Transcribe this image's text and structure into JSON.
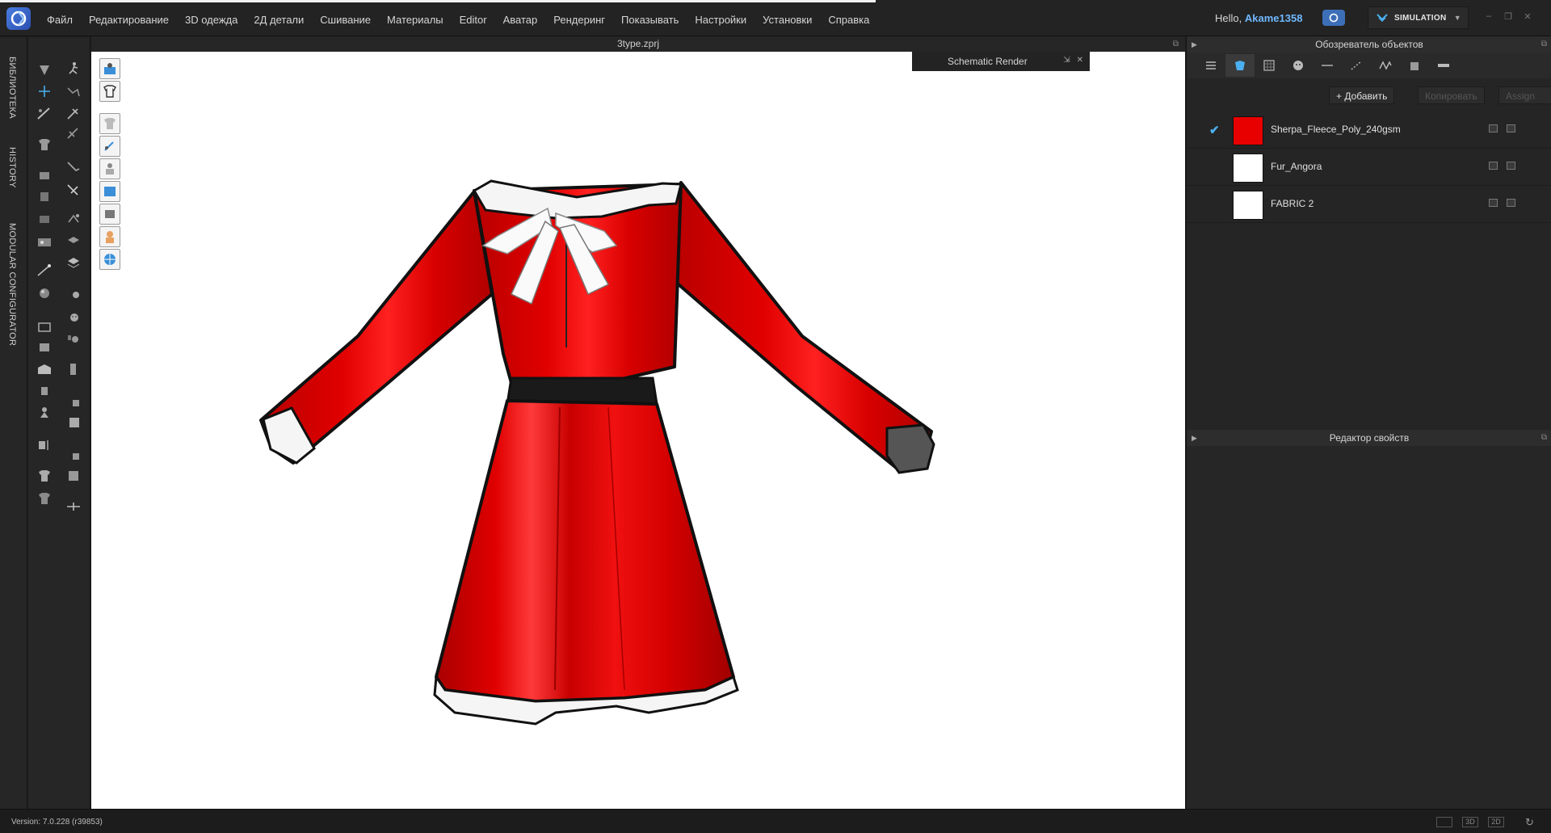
{
  "menubar": {
    "items": [
      "Файл",
      "Редактирование",
      "3D одежда",
      "2Д детали",
      "Сшивание",
      "Материалы",
      "Editor",
      "Аватар",
      "Рендеринг",
      "Показывать",
      "Настройки",
      "Установки",
      "Справка"
    ],
    "hello": "Hello,",
    "username": "Akame1358",
    "mode": "SIMULATION"
  },
  "left_tabs": [
    "БИБЛИОТЕКА",
    "HISTORY",
    "MODULAR CONFIGURATOR"
  ],
  "viewport": {
    "title": "3type.zprj",
    "render_panel_title": "Schematic Render"
  },
  "object_browser": {
    "title": "Обозреватель объектов",
    "add_label": "+ Добавить",
    "copy_label": "Копировать",
    "assign_label": "Assign",
    "materials": [
      {
        "name": "Sherpa_Fleece_Poly_240gsm",
        "color": "#e80000",
        "checked": true
      },
      {
        "name": "Fur_Angora",
        "color": "#ffffff",
        "checked": false
      },
      {
        "name": "FABRIC 2",
        "color": "#ffffff",
        "checked": false
      }
    ]
  },
  "property_editor": {
    "title": "Редактор свойств"
  },
  "status": {
    "version": "Version: 7.0.228 (r39853)",
    "view_buttons": [
      "",
      "3D",
      "2D"
    ]
  },
  "colors": {
    "accent": "#4ab0f0",
    "fabric_red": "#d40000"
  }
}
